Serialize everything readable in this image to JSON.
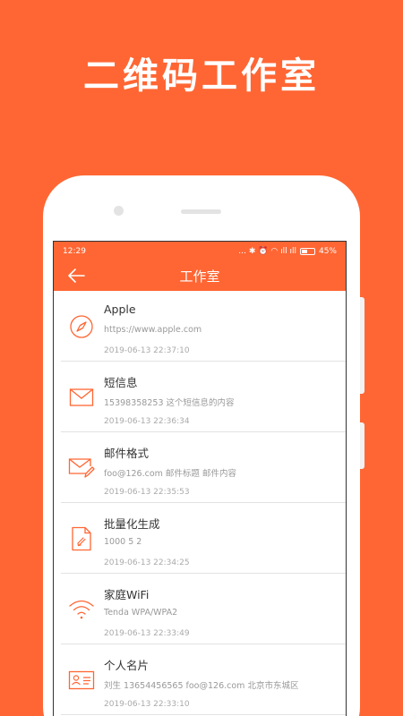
{
  "promo": {
    "title": "二维码工作室"
  },
  "status_bar": {
    "time": "12:29",
    "icons": "… ✱ ⏰ ◠ ıll ıll",
    "battery": "45%",
    "battery_level": 0.45
  },
  "header": {
    "title": "工作室",
    "back_icon": "back-arrow-icon"
  },
  "colors": {
    "accent": "#FF6633",
    "icon": "#FF6633",
    "divider": "#E2E2E2"
  },
  "records": [
    {
      "icon": "compass-icon",
      "title": "Apple",
      "content": "https://www.apple.com",
      "time": "2019-06-13 22:37:10"
    },
    {
      "icon": "envelope-icon",
      "title": "短信息",
      "content": "15398358253 这个短信息的内容",
      "time": "2019-06-13 22:36:34"
    },
    {
      "icon": "mail-edit-icon",
      "title": "邮件格式",
      "content": "foo@126.com 邮件标题 邮件内容",
      "time": "2019-06-13 22:35:53"
    },
    {
      "icon": "document-icon",
      "title": "批量化生成",
      "content": "1000 5 2",
      "time": "2019-06-13 22:34:25"
    },
    {
      "icon": "wifi-icon",
      "title": "家庭WiFi",
      "content": "Tenda WPA/WPA2",
      "time": "2019-06-13 22:33:49"
    },
    {
      "icon": "contact-card-icon",
      "title": "个人名片",
      "content": "刘生 13654456565 foo@126.com 北京市东城区",
      "time": "2019-06-13 22:33:10"
    }
  ]
}
